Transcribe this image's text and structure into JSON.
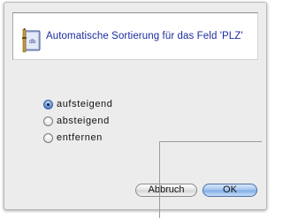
{
  "dialog": {
    "title": "Automatische Sortierung für das Feld 'PLZ'"
  },
  "options": [
    {
      "label": "aufsteigend",
      "checked": true
    },
    {
      "label": "absteigend",
      "checked": false
    },
    {
      "label": "entfernen",
      "checked": false
    }
  ],
  "buttons": {
    "cancel": "Abbruch",
    "ok": "OK"
  },
  "colors": {
    "title_text": "#1b2c9e",
    "dialog_bg": "#ececec",
    "default_button": "#9fc2ee"
  },
  "icons": {
    "header": "filemaker-app-icon"
  }
}
